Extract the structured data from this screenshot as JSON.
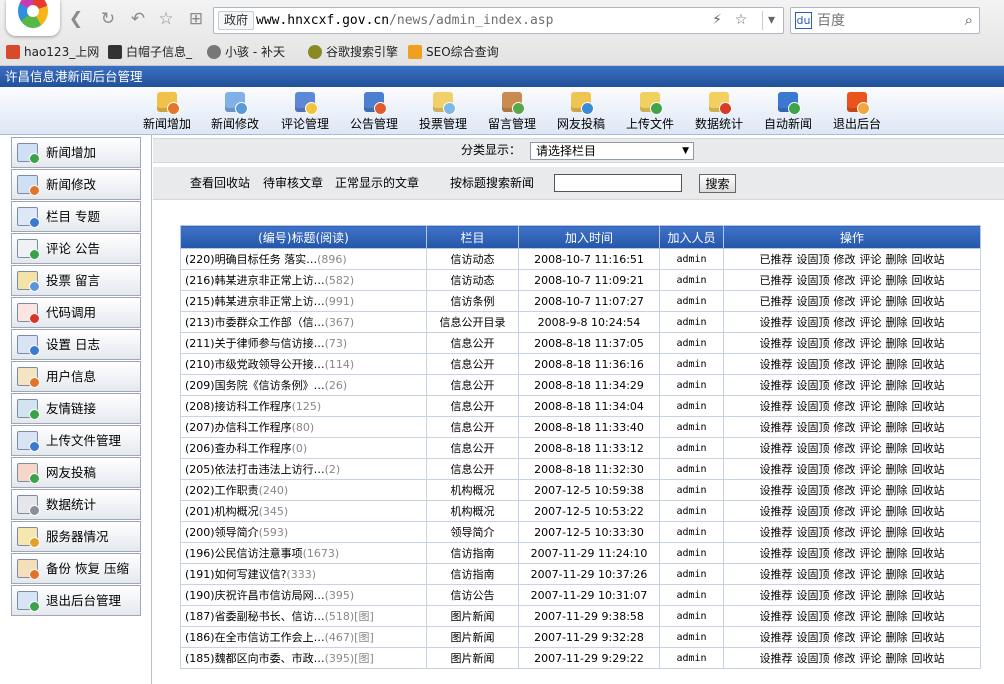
{
  "browser": {
    "address_tag": "政府",
    "url_main": "www.hnxcxf.gov.cn",
    "url_path": "/news/admin_index.asp",
    "search_placeholder": "百度",
    "bookmarks": [
      "hao123_上网",
      "白帽子信息_",
      "小骇 - 补天",
      "谷歌搜索引擎",
      "SEO综合查询"
    ]
  },
  "app": {
    "title": "许昌信息港新闻后台管理"
  },
  "toolbar": {
    "items": [
      {
        "label": "新闻增加",
        "icon": "news-add-icon"
      },
      {
        "label": "新闻修改",
        "icon": "news-edit-icon"
      },
      {
        "label": "评论管理",
        "icon": "comment-icon"
      },
      {
        "label": "公告管理",
        "icon": "notice-icon"
      },
      {
        "label": "投票管理",
        "icon": "vote-icon"
      },
      {
        "label": "留言管理",
        "icon": "message-icon"
      },
      {
        "label": "网友投稿",
        "icon": "submission-icon"
      },
      {
        "label": "上传文件",
        "icon": "upload-icon"
      },
      {
        "label": "数据统计",
        "icon": "statistics-icon"
      },
      {
        "label": "自动新闻",
        "icon": "auto-news-icon"
      },
      {
        "label": "退出后台",
        "icon": "exit-icon"
      }
    ]
  },
  "sidebar": {
    "items": [
      {
        "label": "新闻增加",
        "icon": "news-add-icon"
      },
      {
        "label": "新闻修改",
        "icon": "news-edit-icon"
      },
      {
        "label": "栏目 专题",
        "icon": "column-icon"
      },
      {
        "label": "评论 公告",
        "icon": "comment-icon"
      },
      {
        "label": "投票 留言",
        "icon": "vote-icon"
      },
      {
        "label": "代码调用",
        "icon": "code-icon"
      },
      {
        "label": "设置 日志",
        "icon": "settings-icon"
      },
      {
        "label": "用户信息",
        "icon": "user-icon"
      },
      {
        "label": "友情链接",
        "icon": "link-icon"
      },
      {
        "label": "上传文件管理",
        "icon": "upload-icon"
      },
      {
        "label": "网友投稿",
        "icon": "submission-icon"
      },
      {
        "label": "数据统计",
        "icon": "statistics-icon"
      },
      {
        "label": "服务器情况",
        "icon": "server-icon"
      },
      {
        "label": "备份 恢复 压缩",
        "icon": "backup-icon"
      },
      {
        "label": "退出后台管理",
        "icon": "exit-icon"
      }
    ]
  },
  "filter": {
    "label": "分类显示：",
    "selected": "请选择栏目"
  },
  "actions": {
    "recycle": "查看回收站",
    "pending": "待审核文章",
    "normal": "正常显示的文章",
    "search_label": "按标题搜索新闻",
    "search_value": "",
    "search_button": "搜索"
  },
  "table": {
    "headers": [
      "(编号)标题(阅读)",
      "栏目",
      "加入时间",
      "加入人员",
      "操作"
    ],
    "rows": [
      {
        "title": "(220)明确目标任务 落实…",
        "reads": "(896)",
        "column": "信访动态",
        "time": "2008-10-7 11:16:51",
        "user": "admin",
        "ops": [
          "已推荐",
          "设固顶",
          "修改",
          "评论",
          "删除",
          "回收站"
        ]
      },
      {
        "title": "(216)韩某进京非正常上访…",
        "reads": "(582)",
        "column": "信访动态",
        "time": "2008-10-7 11:09:21",
        "user": "admin",
        "ops": [
          "已推荐",
          "设固顶",
          "修改",
          "评论",
          "删除",
          "回收站"
        ]
      },
      {
        "title": "(215)韩某进京非正常上访…",
        "reads": "(991)",
        "column": "信访条例",
        "time": "2008-10-7 11:07:27",
        "user": "admin",
        "ops": [
          "已推荐",
          "设固顶",
          "修改",
          "评论",
          "删除",
          "回收站"
        ]
      },
      {
        "title": "(213)市委群众工作部（信…",
        "reads": "(367)",
        "column": "信息公开目录",
        "time": "2008-9-8 10:24:54",
        "user": "admin",
        "ops": [
          "设推荐",
          "设固顶",
          "修改",
          "评论",
          "删除",
          "回收站"
        ]
      },
      {
        "title": "(211)关于律师参与信访接…",
        "reads": "(73)",
        "column": "信息公开",
        "time": "2008-8-18 11:37:05",
        "user": "admin",
        "ops": [
          "设推荐",
          "设固顶",
          "修改",
          "评论",
          "删除",
          "回收站"
        ]
      },
      {
        "title": "(210)市级党政领导公开接…",
        "reads": "(114)",
        "column": "信息公开",
        "time": "2008-8-18 11:36:16",
        "user": "admin",
        "ops": [
          "设推荐",
          "设固顶",
          "修改",
          "评论",
          "删除",
          "回收站"
        ]
      },
      {
        "title": "(209)国务院《信访条例》…",
        "reads": "(26)",
        "column": "信息公开",
        "time": "2008-8-18 11:34:29",
        "user": "admin",
        "ops": [
          "设推荐",
          "设固顶",
          "修改",
          "评论",
          "删除",
          "回收站"
        ]
      },
      {
        "title": "(208)接访科工作程序",
        "reads": "(125)",
        "column": "信息公开",
        "time": "2008-8-18 11:34:04",
        "user": "admin",
        "ops": [
          "设推荐",
          "设固顶",
          "修改",
          "评论",
          "删除",
          "回收站"
        ]
      },
      {
        "title": "(207)办信科工作程序",
        "reads": "(80)",
        "column": "信息公开",
        "time": "2008-8-18 11:33:40",
        "user": "admin",
        "ops": [
          "设推荐",
          "设固顶",
          "修改",
          "评论",
          "删除",
          "回收站"
        ]
      },
      {
        "title": "(206)查办科工作程序",
        "reads": "(0)",
        "column": "信息公开",
        "time": "2008-8-18 11:33:12",
        "user": "admin",
        "ops": [
          "设推荐",
          "设固顶",
          "修改",
          "评论",
          "删除",
          "回收站"
        ]
      },
      {
        "title": "(205)依法打击违法上访行…",
        "reads": "(2)",
        "column": "信息公开",
        "time": "2008-8-18 11:32:30",
        "user": "admin",
        "ops": [
          "设推荐",
          "设固顶",
          "修改",
          "评论",
          "删除",
          "回收站"
        ]
      },
      {
        "title": "(202)工作职责",
        "reads": "(240)",
        "column": "机构概况",
        "time": "2007-12-5 10:59:38",
        "user": "admin",
        "ops": [
          "设推荐",
          "设固顶",
          "修改",
          "评论",
          "删除",
          "回收站"
        ]
      },
      {
        "title": "(201)机构概况",
        "reads": "(345)",
        "column": "机构概况",
        "time": "2007-12-5 10:53:22",
        "user": "admin",
        "ops": [
          "设推荐",
          "设固顶",
          "修改",
          "评论",
          "删除",
          "回收站"
        ]
      },
      {
        "title": "(200)领导简介",
        "reads": "(593)",
        "column": "领导简介",
        "time": "2007-12-5 10:33:30",
        "user": "admin",
        "ops": [
          "设推荐",
          "设固顶",
          "修改",
          "评论",
          "删除",
          "回收站"
        ]
      },
      {
        "title": "(196)公民信访注意事项",
        "reads": "(1673)",
        "column": "信访指南",
        "time": "2007-11-29 11:24:10",
        "user": "admin",
        "ops": [
          "设推荐",
          "设固顶",
          "修改",
          "评论",
          "删除",
          "回收站"
        ]
      },
      {
        "title": "(191)如何写建议信?",
        "reads": "(333)",
        "column": "信访指南",
        "time": "2007-11-29 10:37:26",
        "user": "admin",
        "ops": [
          "设推荐",
          "设固顶",
          "修改",
          "评论",
          "删除",
          "回收站"
        ]
      },
      {
        "title": "(190)庆祝许昌市信访局网…",
        "reads": "(395)",
        "column": "信访公告",
        "time": "2007-11-29 10:31:07",
        "user": "admin",
        "ops": [
          "设推荐",
          "设固顶",
          "修改",
          "评论",
          "删除",
          "回收站"
        ]
      },
      {
        "title": "(187)省委副秘书长、信访…",
        "reads": "(518)[图]",
        "column": "图片新闻",
        "time": "2007-11-29 9:38:58",
        "user": "admin",
        "ops": [
          "设推荐",
          "设固顶",
          "修改",
          "评论",
          "删除",
          "回收站"
        ]
      },
      {
        "title": "(186)在全市信访工作会上…",
        "reads": "(467)[图]",
        "column": "图片新闻",
        "time": "2007-11-29 9:32:28",
        "user": "admin",
        "ops": [
          "设推荐",
          "设固顶",
          "修改",
          "评论",
          "删除",
          "回收站"
        ]
      },
      {
        "title": "(185)魏都区向市委、市政…",
        "reads": "(395)[图]",
        "column": "图片新闻",
        "time": "2007-11-29 9:29:22",
        "user": "admin",
        "ops": [
          "设推荐",
          "设固顶",
          "修改",
          "评论",
          "删除",
          "回收站"
        ]
      }
    ]
  },
  "colors": {
    "titlebar": "#215199",
    "table_header": "#2e62b6",
    "sidebar_border": "#9fa8b5",
    "panel_gray": "#e9eaec"
  }
}
